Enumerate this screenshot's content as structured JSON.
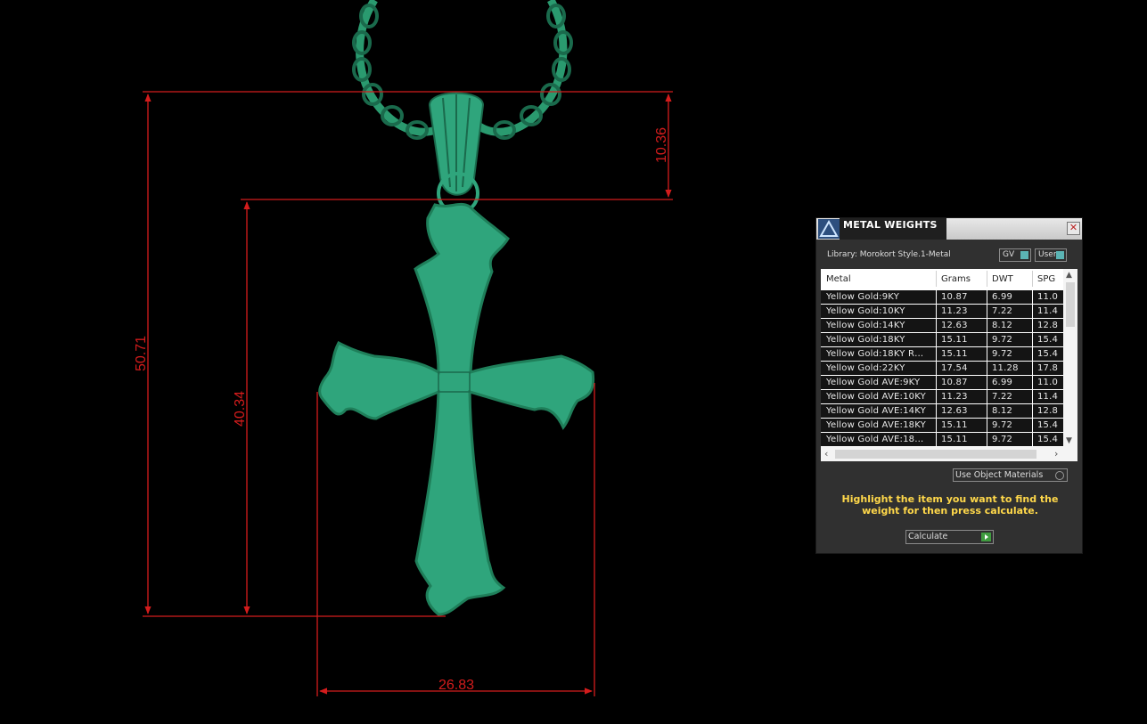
{
  "dimensions": {
    "total_height": "50.71",
    "body_height": "40.34",
    "bail_height": "10.36",
    "width": "26.83"
  },
  "colors": {
    "dimension_line": "#d41c1c",
    "model": "#2fa57c",
    "model_edge": "#1f7f5a",
    "panel_bg": "#303030",
    "hint_text": "#ffd84a",
    "toggle_knob": "#5bb4b4",
    "play_icon": "#3f9c3f"
  },
  "panel": {
    "title": "METAL WEIGHTS",
    "library": "Library: Morokort Style.1-Metal",
    "toggle_gv": "GV",
    "toggle_user": "User",
    "columns": [
      "Metal",
      "Grams",
      "DWT",
      "SPG"
    ],
    "rows": [
      [
        "Yellow Gold:9KY",
        "10.87",
        "6.99",
        "11.0"
      ],
      [
        "Yellow Gold:10KY",
        "11.23",
        "7.22",
        "11.4"
      ],
      [
        "Yellow Gold:14KY",
        "12.63",
        "8.12",
        "12.8"
      ],
      [
        "Yellow Gold:18KY",
        "15.11",
        "9.72",
        "15.4"
      ],
      [
        "Yellow Gold:18KY R…",
        "15.11",
        "9.72",
        "15.4"
      ],
      [
        "Yellow Gold:22KY",
        "17.54",
        "11.28",
        "17.8"
      ],
      [
        "Yellow Gold AVE:9KY",
        "10.87",
        "6.99",
        "11.0"
      ],
      [
        "Yellow Gold AVE:10KY",
        "11.23",
        "7.22",
        "11.4"
      ],
      [
        "Yellow Gold AVE:14KY",
        "12.63",
        "8.12",
        "12.8"
      ],
      [
        "Yellow Gold AVE:18KY",
        "15.11",
        "9.72",
        "15.4"
      ],
      [
        "Yellow Gold AVE:18…",
        "15.11",
        "9.72",
        "15.4"
      ]
    ],
    "use_materials": "Use Object Materials",
    "hint": "Highlight the item you want to find the weight for then press calculate.",
    "calculate": "Calculate"
  }
}
